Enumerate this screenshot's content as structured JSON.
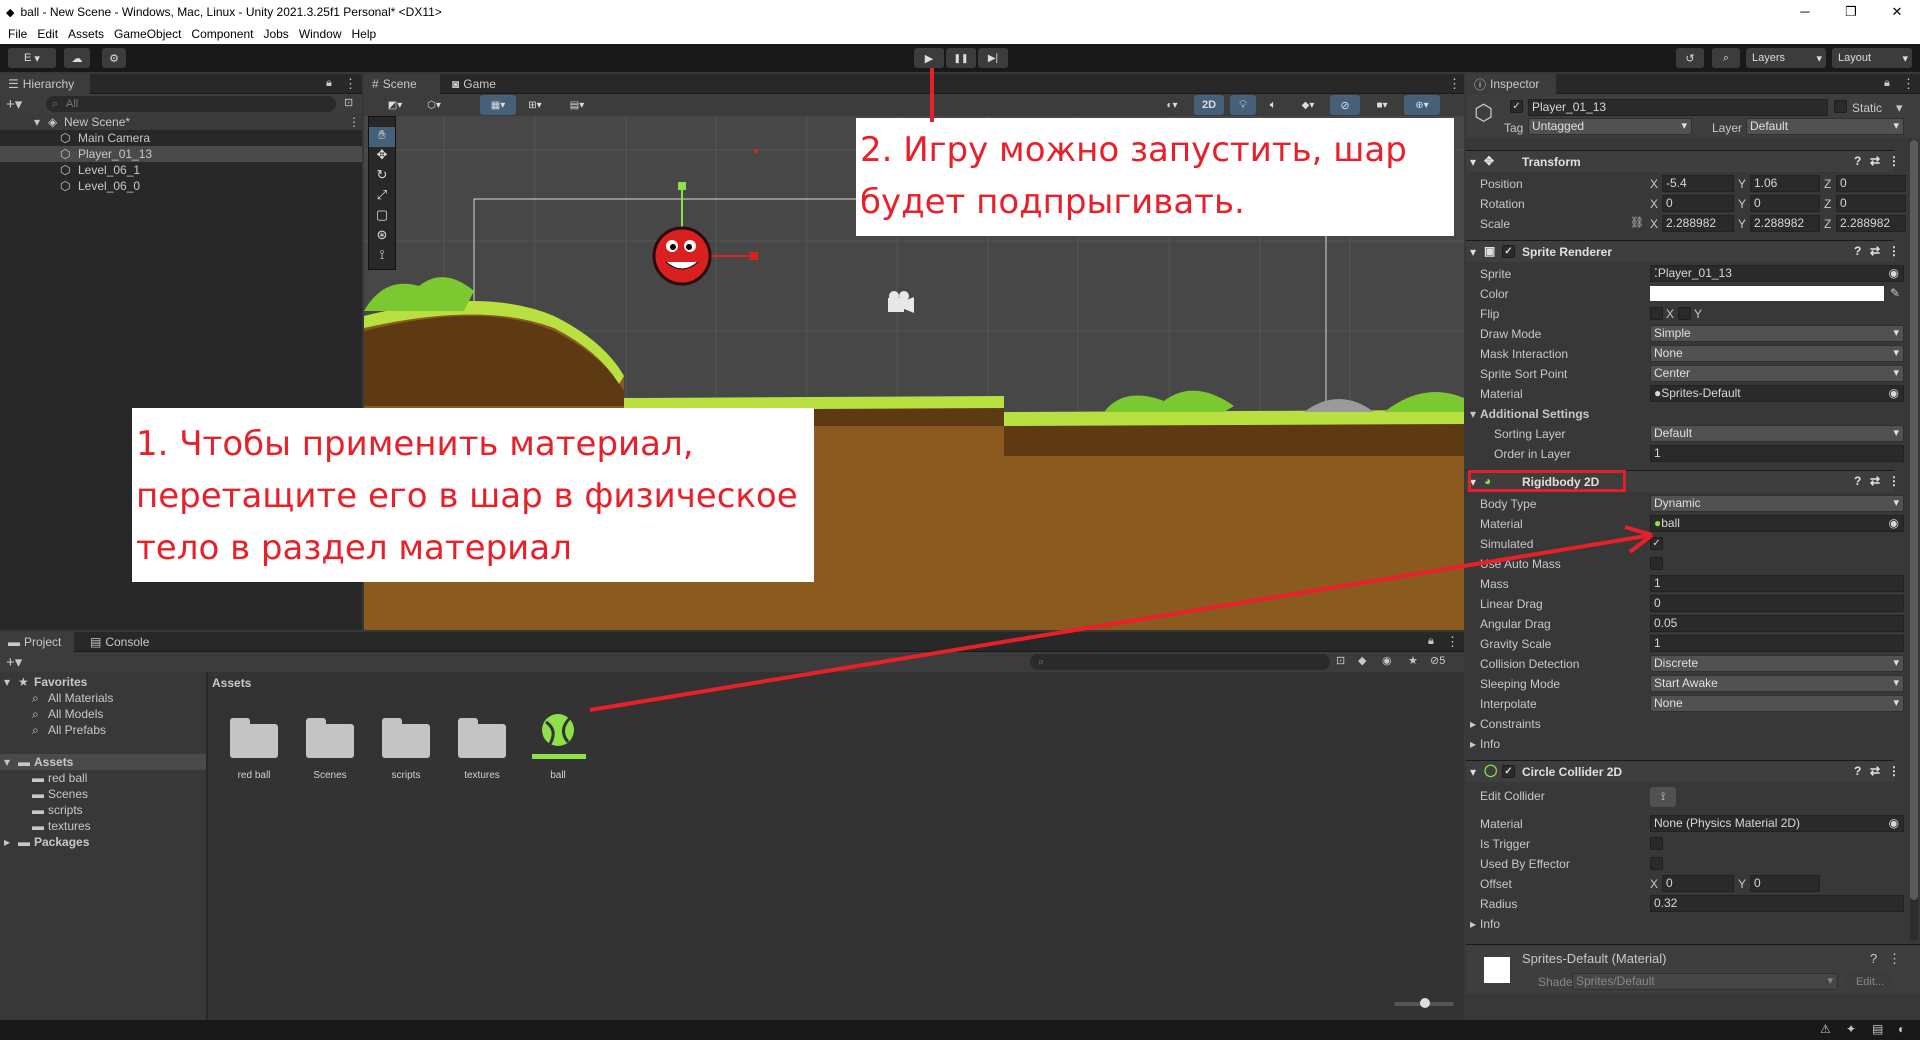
{
  "window": {
    "title": "ball - New Scene - Windows, Mac, Linux - Unity 2021.3.25f1 Personal* <DX11>",
    "minimize": "─",
    "maximize": "❐",
    "close": "✕"
  },
  "menu": [
    "File",
    "Edit",
    "Assets",
    "GameObject",
    "Component",
    "Jobs",
    "Window",
    "Help"
  ],
  "toolbar": {
    "account": "E",
    "layers": "Layers",
    "layout": "Layout",
    "play": "▶",
    "pause": "❚❚",
    "step": "▶|"
  },
  "hierarchy": {
    "tab": "Hierarchy",
    "search_placeholder": "All",
    "scene": "New Scene*",
    "items": [
      "Main Camera",
      "Player_01_13",
      "Level_06_1",
      "Level_06_0"
    ]
  },
  "scene_view": {
    "tabs": [
      "Scene",
      "Game"
    ],
    "mode_2d": "2D"
  },
  "callouts": {
    "one": "1. Чтобы применить материал, перетащите его в шар в физическое тело в раздел материал",
    "two": "2. Игру можно запустить, шар будет подпрыгивать."
  },
  "project": {
    "tabs": [
      "Project",
      "Console"
    ],
    "favorites_label": "Favorites",
    "favorites": [
      "All Materials",
      "All Models",
      "All Prefabs"
    ],
    "assets_label": "Assets",
    "asset_folders": [
      "red ball",
      "Scenes",
      "scripts",
      "textures"
    ],
    "packages_label": "Packages",
    "breadcrumb": "Assets",
    "hidden_count": "5",
    "grid_items": [
      "red ball",
      "Scenes",
      "scripts",
      "textures",
      "ball"
    ]
  },
  "inspector": {
    "tab": "Inspector",
    "object_name": "Player_01_13",
    "static_label": "Static",
    "tag_label": "Tag",
    "tag_value": "Untagged",
    "layer_label": "Layer",
    "layer_value": "Default",
    "transform": {
      "title": "Transform",
      "position_label": "Position",
      "rotation_label": "Rotation",
      "scale_label": "Scale",
      "position": [
        "-5.4",
        "1.06",
        "0"
      ],
      "rotation": [
        "0",
        "0",
        "0"
      ],
      "scale": [
        "2.288982",
        "2.288982",
        "2.288982"
      ],
      "axis": [
        "X",
        "Y",
        "Z"
      ]
    },
    "sprite_renderer": {
      "title": "Sprite Renderer",
      "sprite_label": "Sprite",
      "sprite": "Player_01_13",
      "color_label": "Color",
      "flip_label": "Flip",
      "flip_x": "X",
      "flip_y": "Y",
      "draw_mode_label": "Draw Mode",
      "draw_mode": "Simple",
      "mask_label": "Mask Interaction",
      "mask": "None",
      "sort_point_label": "Sprite Sort Point",
      "sort_point": "Center",
      "material_label": "Material",
      "material": "Sprites-Default",
      "additional": "Additional Settings",
      "sorting_layer_label": "Sorting Layer",
      "sorting_layer": "Default",
      "order_label": "Order in Layer",
      "order": "1"
    },
    "rigidbody": {
      "title": "Rigidbody 2D",
      "body_type_label": "Body Type",
      "body_type": "Dynamic",
      "material_label": "Material",
      "material": "ball",
      "simulated_label": "Simulated",
      "auto_mass_label": "Use Auto Mass",
      "mass_label": "Mass",
      "mass": "1",
      "linear_drag_label": "Linear Drag",
      "linear_drag": "0",
      "angular_drag_label": "Angular Drag",
      "angular_drag": "0.05",
      "gravity_label": "Gravity Scale",
      "gravity": "1",
      "collision_label": "Collision Detection",
      "collision": "Discrete",
      "sleeping_label": "Sleeping Mode",
      "sleeping": "Start Awake",
      "interpolate_label": "Interpolate",
      "interpolate": "None",
      "constraints_label": "Constraints",
      "info_label": "Info"
    },
    "circle_collider": {
      "title": "Circle Collider 2D",
      "edit_label": "Edit Collider",
      "material_label": "Material",
      "material": "None (Physics Material 2D)",
      "trigger_label": "Is Trigger",
      "effector_label": "Used By Effector",
      "offset_label": "Offset",
      "offset_x": "0",
      "offset_y": "0",
      "radius_label": "Radius",
      "radius": "0.32",
      "info_label": "Info"
    },
    "material_preview": {
      "title": "Sprites-Default (Material)",
      "shader_label": "Shader",
      "shader": "Sprites/Default",
      "edit": "Edit..."
    }
  },
  "colors": {
    "accent_red": "#e8202a",
    "ball_green": "#8ee04a",
    "highlight_red": "#e0202a"
  }
}
